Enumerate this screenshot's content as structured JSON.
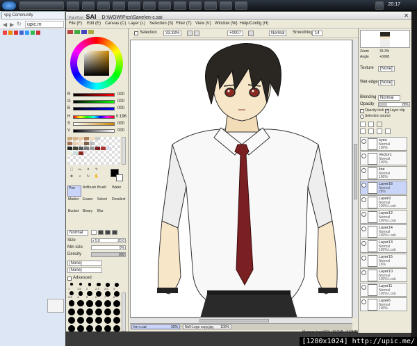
{
  "taskbar": {
    "chrome_tab_label": "vpg Community",
    "clock": "20:17"
  },
  "chrome": {
    "url": "upic.m"
  },
  "sai": {
    "brand": "SAI",
    "app_name": "PaintTool",
    "title": "D:\\WOW\\Pics\\Save\\en-c.sai",
    "menu": [
      "File (F)",
      "Edit (E)",
      "Canvas (C)",
      "Layer (L)",
      "Selection (S)",
      "Filter (T)",
      "View (V)",
      "Window (W)",
      "Help/Config (H)"
    ],
    "toolbar": {
      "selection_label": "Selection",
      "zoom": "33.33%",
      "angle": "+0007",
      "mode": "Normal",
      "smoothing_label": "Smoothing",
      "smoothing_value": "14"
    },
    "color": {
      "channels": [
        {
          "name": "R",
          "value": "000"
        },
        {
          "name": "G",
          "value": "000"
        },
        {
          "name": "B",
          "value": "000"
        },
        {
          "name": "H",
          "value": "0:196"
        },
        {
          "name": "S",
          "value": "000"
        },
        {
          "name": "V",
          "value": "000"
        }
      ]
    },
    "tools": {
      "row1": [
        "Pen",
        "AirBrush",
        "Brush",
        "Water"
      ],
      "row2": [
        "Marker",
        "Eraser",
        "Select",
        "Deselect"
      ],
      "row3": [
        "Bucket",
        "Binary",
        "Blur"
      ]
    },
    "brush": {
      "mode": "Normal",
      "size_label": "Size",
      "size_mult": "x 5.0",
      "size_value": "20.0",
      "min_size_label": "Min size",
      "min_size_value": "0%",
      "density_label": "Density",
      "density_value": "100",
      "option1": "[None]",
      "option2": "[None]",
      "advanced_label": "Advanced",
      "sizes": [
        "1",
        "1.5",
        "2",
        "2.3",
        "2.6",
        "3",
        "3.5",
        "4",
        "5",
        "6",
        "7",
        "8",
        "9",
        "10",
        "12",
        "14",
        "16",
        "20",
        "25",
        "30",
        "35",
        "40",
        "50",
        "60",
        "70",
        "80",
        "100",
        "120",
        "160",
        "200",
        "250",
        "300",
        "350",
        "400",
        "450",
        "500"
      ]
    },
    "navigator": {
      "zoom_label": "Zoom",
      "zoom_value": "33.3%",
      "angle_label": "Angle",
      "angle_value": "+0008"
    },
    "layer_props": {
      "texture_label": "Texture",
      "texture_value": "[None]",
      "wet_edge_label": "Wet edge",
      "wet_edge_value": "[None]",
      "blend_label": "Blending",
      "blend_value": "Normal",
      "opacity_label": "Opacity",
      "opacity_value": "28%",
      "opacity_lock_label": "Opacity lock",
      "layer_clip_label": "Layer clip",
      "selection_source_label": "Selection source"
    },
    "layers": [
      {
        "name": "eyes",
        "mode": "Normal",
        "opacity": "100%",
        "selected": false
      },
      {
        "name": "Vector1",
        "mode": "Normal",
        "opacity": "100%",
        "selected": false
      },
      {
        "name": "line",
        "mode": "Normal",
        "opacity": "100%",
        "selected": false
      },
      {
        "name": "Layer16",
        "mode": "Normal",
        "opacity": "28%",
        "selected": true
      },
      {
        "name": "Layer9",
        "mode": "Normal",
        "opacity": "100% Lock",
        "selected": false
      },
      {
        "name": "Layer12",
        "mode": "Normal",
        "opacity": "100% Lock",
        "selected": false
      },
      {
        "name": "Layer14",
        "mode": "Normal",
        "opacity": "100% Lock",
        "selected": false
      },
      {
        "name": "Layer13",
        "mode": "Normal",
        "opacity": "100% Lock",
        "selected": false
      },
      {
        "name": "Layer15",
        "mode": "Normal",
        "opacity": "16%",
        "selected": false
      },
      {
        "name": "Layer10",
        "mode": "Normal",
        "opacity": "100% Lock",
        "selected": false
      },
      {
        "name": "Layer11",
        "mode": "Normal",
        "opacity": "100% Lock",
        "selected": false
      },
      {
        "name": "Layer6",
        "mode": "Normal",
        "opacity": "100%",
        "selected": false
      }
    ],
    "docs": [
      {
        "name": "len-c.sai",
        "zoom": "33%"
      },
      {
        "name": "Nell-Logo copy.jpg",
        "zoom": "100%"
      }
    ],
    "status": "Memory load:65% (357MB / 919MB)",
    "status_keys": "Shift Ctrl Alt SPC Any"
  },
  "watermark": "[1280x1024] http://upic.me/",
  "colors": {
    "hair": "#2a2622",
    "tie": "#7a1f22",
    "skin": "#f7e6c8",
    "eye": "#8a2a20"
  }
}
